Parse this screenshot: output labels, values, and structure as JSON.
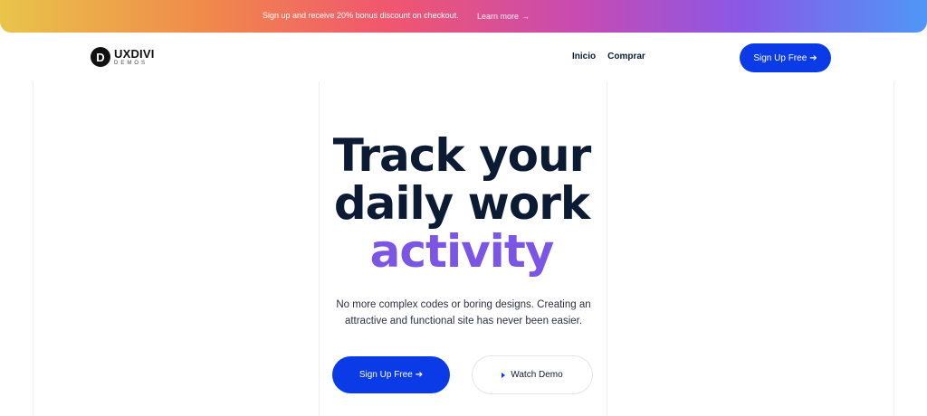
{
  "announcement": {
    "text": "Sign up and receive 20% bonus discount on checkout.",
    "link_label": "Learn more",
    "link_arrow": "→"
  },
  "logo": {
    "mark": "D",
    "name": "UXDIVI",
    "subtitle": "DEMOS"
  },
  "nav": {
    "items": [
      {
        "label": "Inicio"
      },
      {
        "label": "Comprar"
      }
    ]
  },
  "header": {
    "cta_label": "Sign Up Free",
    "cta_arrow": "➔"
  },
  "hero": {
    "title_line1": "Track your",
    "title_line2": "daily work",
    "title_accent": "activity",
    "subtitle": "No more complex codes or boring designs. Creating an attractive and functional site has never been easier.",
    "primary_label": "Sign Up Free",
    "primary_arrow": "➔",
    "secondary_label": "Watch Demo"
  },
  "colors": {
    "brand_blue": "#0a3be6",
    "accent_purple": "#7b55e3",
    "heading": "#0b1b33"
  },
  "icons": [
    "arrow-right-icon",
    "play-icon"
  ]
}
